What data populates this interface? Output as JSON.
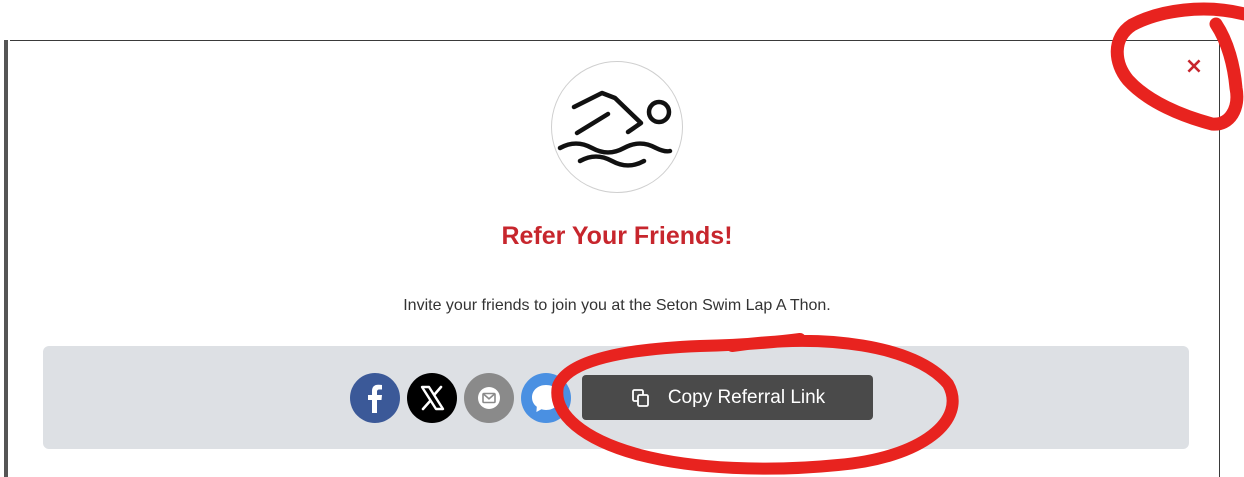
{
  "modal": {
    "title": "Refer Your Friends!",
    "subtitle": "Invite your friends to join you at the Seton Swim Lap A Thon.",
    "close_label": "×",
    "logo_icon": "swimmer-icon"
  },
  "share": {
    "buttons": [
      {
        "name": "facebook",
        "icon": "facebook-icon",
        "color": "#3b5998"
      },
      {
        "name": "x",
        "icon": "x-icon",
        "color": "#000000"
      },
      {
        "name": "email",
        "icon": "email-icon",
        "color": "#8a8a8a"
      },
      {
        "name": "messenger",
        "icon": "messenger-icon",
        "color": "#4a90e2"
      }
    ],
    "copy_label": "Copy Referral Link",
    "copy_icon": "copy-icon"
  },
  "colors": {
    "accent": "#c7262d",
    "share_bar_bg": "#dde0e4",
    "copy_button_bg": "#4a4a4a",
    "annotation": "#e8231f"
  }
}
